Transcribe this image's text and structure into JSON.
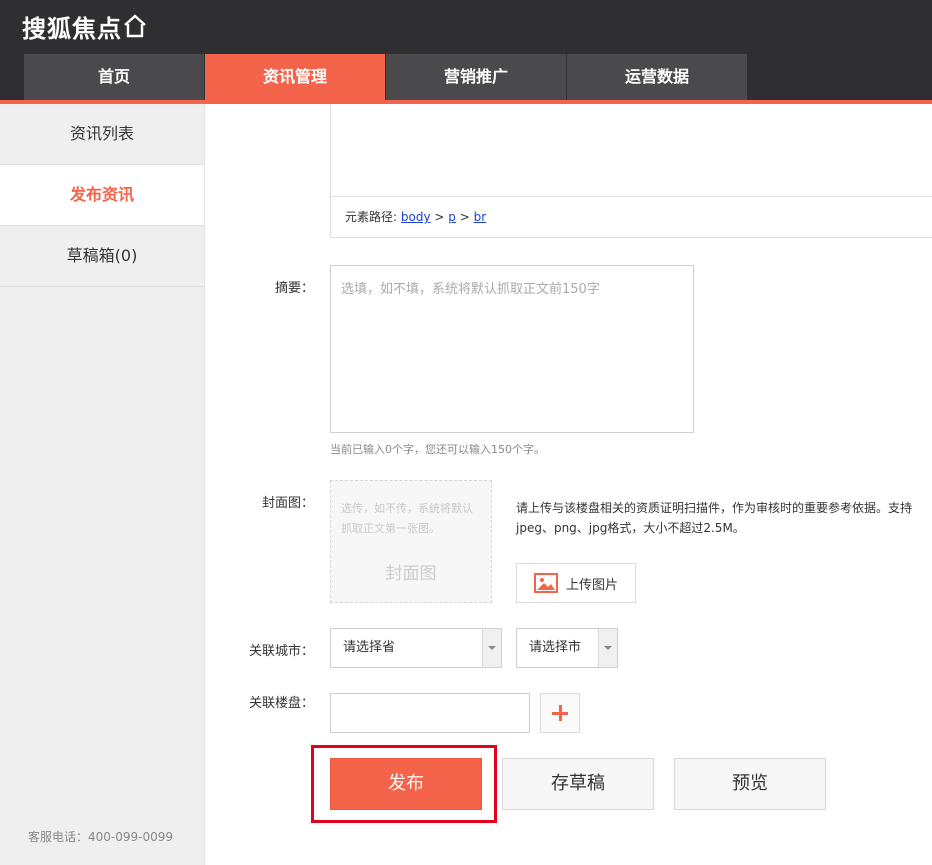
{
  "brand": {
    "logo_text": "搜狐焦点"
  },
  "nav": {
    "tabs": [
      {
        "label": "首页"
      },
      {
        "label": "资讯管理"
      },
      {
        "label": "营销推广"
      },
      {
        "label": "运营数据"
      }
    ],
    "active_index": 1
  },
  "sidebar": {
    "items": [
      {
        "label": "资讯列表"
      },
      {
        "label": "发布资讯"
      },
      {
        "label": "草稿箱(0)"
      }
    ],
    "active_index": 1,
    "phone": "客服电话：400-099-0099"
  },
  "editor": {
    "path_label": "元素路径:",
    "path": [
      "body",
      "p",
      "br"
    ],
    "separator": ">"
  },
  "form": {
    "summary": {
      "label": "摘要：",
      "placeholder": "选填，如不填，系统将默认抓取正文前150字",
      "hint": "当前已输入0个字，您还可以输入150个字。"
    },
    "cover": {
      "label": "封面图：",
      "note": "选传，如不传，系统将默认抓取正文第一张图。",
      "title": "封面图",
      "desc": "请上传与该楼盘相关的资质证明扫描件，作为审核时的重要参考依据。支持jpeg、png、jpg格式，大小不超过2.5M。",
      "upload_label": "上传图片"
    },
    "city": {
      "label": "关联城市：",
      "province_value": "请选择省",
      "city_value": "请选择市"
    },
    "building": {
      "label": "关联楼盘："
    }
  },
  "actions": {
    "publish": "发布",
    "draft": "存草稿",
    "preview": "预览"
  },
  "colors": {
    "accent": "#f4644a",
    "header_bg": "#2f2f31",
    "tab_bg": "#4a4a4c",
    "highlight": "#e3001b"
  }
}
